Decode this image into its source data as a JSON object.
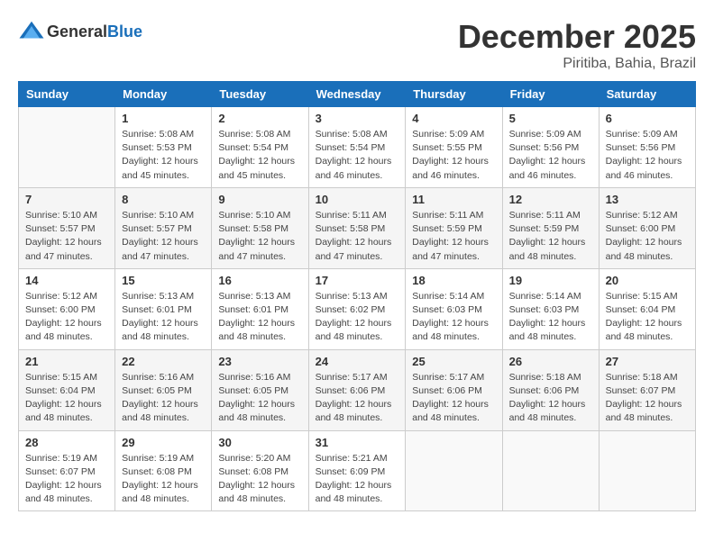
{
  "header": {
    "logo_general": "General",
    "logo_blue": "Blue",
    "month_year": "December 2025",
    "location": "Piritiba, Bahia, Brazil"
  },
  "weekdays": [
    "Sunday",
    "Monday",
    "Tuesday",
    "Wednesday",
    "Thursday",
    "Friday",
    "Saturday"
  ],
  "weeks": [
    [
      {
        "day": "",
        "info": ""
      },
      {
        "day": "1",
        "info": "Sunrise: 5:08 AM\nSunset: 5:53 PM\nDaylight: 12 hours\nand 45 minutes."
      },
      {
        "day": "2",
        "info": "Sunrise: 5:08 AM\nSunset: 5:54 PM\nDaylight: 12 hours\nand 45 minutes."
      },
      {
        "day": "3",
        "info": "Sunrise: 5:08 AM\nSunset: 5:54 PM\nDaylight: 12 hours\nand 46 minutes."
      },
      {
        "day": "4",
        "info": "Sunrise: 5:09 AM\nSunset: 5:55 PM\nDaylight: 12 hours\nand 46 minutes."
      },
      {
        "day": "5",
        "info": "Sunrise: 5:09 AM\nSunset: 5:56 PM\nDaylight: 12 hours\nand 46 minutes."
      },
      {
        "day": "6",
        "info": "Sunrise: 5:09 AM\nSunset: 5:56 PM\nDaylight: 12 hours\nand 46 minutes."
      }
    ],
    [
      {
        "day": "7",
        "info": "Sunrise: 5:10 AM\nSunset: 5:57 PM\nDaylight: 12 hours\nand 47 minutes."
      },
      {
        "day": "8",
        "info": "Sunrise: 5:10 AM\nSunset: 5:57 PM\nDaylight: 12 hours\nand 47 minutes."
      },
      {
        "day": "9",
        "info": "Sunrise: 5:10 AM\nSunset: 5:58 PM\nDaylight: 12 hours\nand 47 minutes."
      },
      {
        "day": "10",
        "info": "Sunrise: 5:11 AM\nSunset: 5:58 PM\nDaylight: 12 hours\nand 47 minutes."
      },
      {
        "day": "11",
        "info": "Sunrise: 5:11 AM\nSunset: 5:59 PM\nDaylight: 12 hours\nand 47 minutes."
      },
      {
        "day": "12",
        "info": "Sunrise: 5:11 AM\nSunset: 5:59 PM\nDaylight: 12 hours\nand 48 minutes."
      },
      {
        "day": "13",
        "info": "Sunrise: 5:12 AM\nSunset: 6:00 PM\nDaylight: 12 hours\nand 48 minutes."
      }
    ],
    [
      {
        "day": "14",
        "info": "Sunrise: 5:12 AM\nSunset: 6:00 PM\nDaylight: 12 hours\nand 48 minutes."
      },
      {
        "day": "15",
        "info": "Sunrise: 5:13 AM\nSunset: 6:01 PM\nDaylight: 12 hours\nand 48 minutes."
      },
      {
        "day": "16",
        "info": "Sunrise: 5:13 AM\nSunset: 6:01 PM\nDaylight: 12 hours\nand 48 minutes."
      },
      {
        "day": "17",
        "info": "Sunrise: 5:13 AM\nSunset: 6:02 PM\nDaylight: 12 hours\nand 48 minutes."
      },
      {
        "day": "18",
        "info": "Sunrise: 5:14 AM\nSunset: 6:03 PM\nDaylight: 12 hours\nand 48 minutes."
      },
      {
        "day": "19",
        "info": "Sunrise: 5:14 AM\nSunset: 6:03 PM\nDaylight: 12 hours\nand 48 minutes."
      },
      {
        "day": "20",
        "info": "Sunrise: 5:15 AM\nSunset: 6:04 PM\nDaylight: 12 hours\nand 48 minutes."
      }
    ],
    [
      {
        "day": "21",
        "info": "Sunrise: 5:15 AM\nSunset: 6:04 PM\nDaylight: 12 hours\nand 48 minutes."
      },
      {
        "day": "22",
        "info": "Sunrise: 5:16 AM\nSunset: 6:05 PM\nDaylight: 12 hours\nand 48 minutes."
      },
      {
        "day": "23",
        "info": "Sunrise: 5:16 AM\nSunset: 6:05 PM\nDaylight: 12 hours\nand 48 minutes."
      },
      {
        "day": "24",
        "info": "Sunrise: 5:17 AM\nSunset: 6:06 PM\nDaylight: 12 hours\nand 48 minutes."
      },
      {
        "day": "25",
        "info": "Sunrise: 5:17 AM\nSunset: 6:06 PM\nDaylight: 12 hours\nand 48 minutes."
      },
      {
        "day": "26",
        "info": "Sunrise: 5:18 AM\nSunset: 6:06 PM\nDaylight: 12 hours\nand 48 minutes."
      },
      {
        "day": "27",
        "info": "Sunrise: 5:18 AM\nSunset: 6:07 PM\nDaylight: 12 hours\nand 48 minutes."
      }
    ],
    [
      {
        "day": "28",
        "info": "Sunrise: 5:19 AM\nSunset: 6:07 PM\nDaylight: 12 hours\nand 48 minutes."
      },
      {
        "day": "29",
        "info": "Sunrise: 5:19 AM\nSunset: 6:08 PM\nDaylight: 12 hours\nand 48 minutes."
      },
      {
        "day": "30",
        "info": "Sunrise: 5:20 AM\nSunset: 6:08 PM\nDaylight: 12 hours\nand 48 minutes."
      },
      {
        "day": "31",
        "info": "Sunrise: 5:21 AM\nSunset: 6:09 PM\nDaylight: 12 hours\nand 48 minutes."
      },
      {
        "day": "",
        "info": ""
      },
      {
        "day": "",
        "info": ""
      },
      {
        "day": "",
        "info": ""
      }
    ]
  ]
}
